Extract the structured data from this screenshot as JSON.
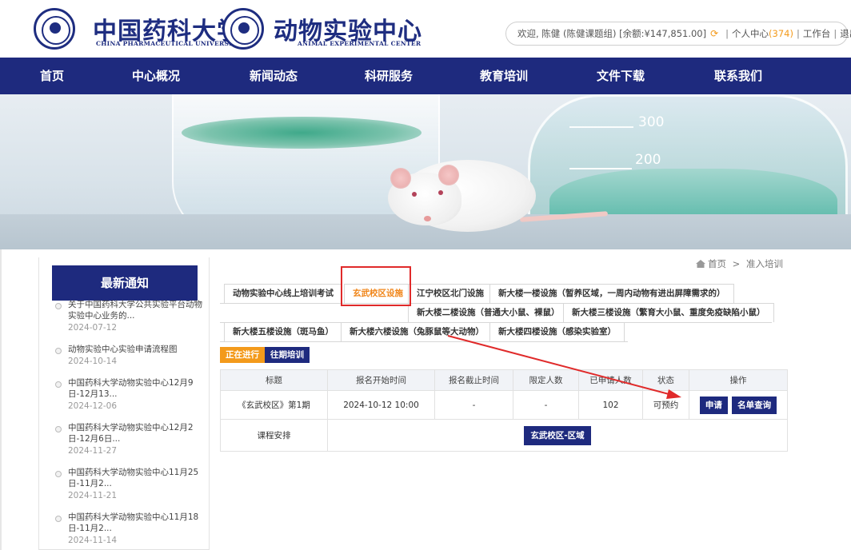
{
  "header": {
    "logo1_cn": "中国药科大学",
    "logo1_en": "CHINA PHARMACEUTICAL UNIVERSITY",
    "logo2_cn": "动物实验中心",
    "logo2_en": "ANIMAL EXPERIMENTAL CENTER",
    "user": {
      "welcome": "欢迎, 陈健 (陈健课题组) [余额:¥147,851.00]",
      "personal_center": "个人中心",
      "personal_center_count": "(374)",
      "workbench": "工作台",
      "logout": "退出",
      "sep": "|"
    }
  },
  "nav": {
    "items": [
      {
        "label": "首页"
      },
      {
        "label": "中心概况"
      },
      {
        "label": "新闻动态"
      },
      {
        "label": "科研服务"
      },
      {
        "label": "教育培训"
      },
      {
        "label": "文件下载"
      },
      {
        "label": "联系我们"
      }
    ]
  },
  "banner": {
    "mark_300": "300",
    "mark_200": "200"
  },
  "sidebar": {
    "title": "最新通知",
    "notices": [
      {
        "title": "关于中国药科大学公共实验平台动物实验中心业务的...",
        "date": "2024-07-12"
      },
      {
        "title": "动物实验中心实验申请流程图",
        "date": "2024-10-14"
      },
      {
        "title": "中国药科大学动物实验中心12月9日-12月13...",
        "date": "2024-12-06"
      },
      {
        "title": "中国药科大学动物实验中心12月2日-12月6日...",
        "date": "2024-11-27"
      },
      {
        "title": "中国药科大学动物实验中心11月25日-11月2...",
        "date": "2024-11-21"
      },
      {
        "title": "中国药科大学动物实验中心11月18日-11月2...",
        "date": "2024-11-14"
      }
    ]
  },
  "breadcrumb": {
    "home": "首页",
    "sep": ">",
    "current": "准入培训"
  },
  "tabs": {
    "row1": [
      "动物实验中心线上培训考试",
      "玄武校区设施",
      "江宁校区北门设施",
      "新大楼一楼设施（暂养区域，一周内动物有进出屏障需求的）"
    ],
    "row2": [
      "新大楼二楼设施（普通大小鼠、裸鼠）",
      "新大楼三楼设施（繁育大小鼠、重度免疫缺陷小鼠）"
    ],
    "row3": [
      "新大楼五楼设施（斑马鱼）",
      "新大楼六楼设施（兔豚鼠等大动物）",
      "新大楼四楼设施（感染实验室）"
    ]
  },
  "status_filter": {
    "ongoing": "正在进行",
    "past": "往期培训"
  },
  "table": {
    "headers": [
      "标题",
      "报名开始时间",
      "报名截止时间",
      "限定人数",
      "已申请人数",
      "状态",
      "操作"
    ],
    "rows": [
      {
        "title": "《玄武校区》第1期",
        "start": "2024-10-12 10:00",
        "end": "-",
        "limit": "-",
        "applied": "102",
        "status": "可预约",
        "apply_btn": "申请",
        "list_btn": "名单查询"
      }
    ],
    "schedule_label": "课程安排",
    "schedule_btn": "玄武校区-区域"
  },
  "colors": {
    "navy": "#1e2a7e",
    "orange": "#f08519",
    "annotation_red": "#e02a2a"
  }
}
